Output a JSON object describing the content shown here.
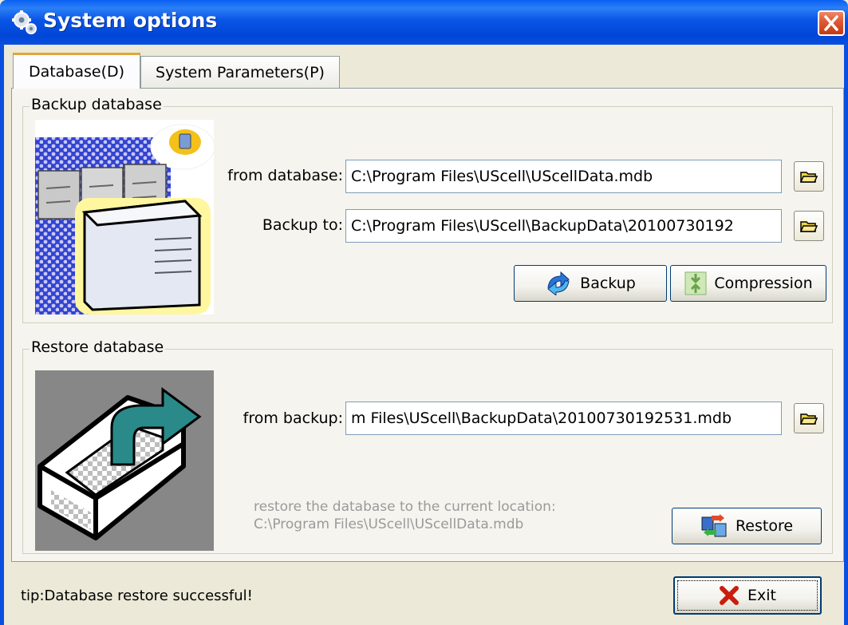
{
  "window": {
    "title": "System options"
  },
  "tabs": [
    {
      "label": "Database(D)",
      "active": true
    },
    {
      "label": "System Parameters(P)",
      "active": false
    }
  ],
  "backup": {
    "group_title": "Backup database",
    "from_label": "from database:",
    "from_value": "C:\\Program Files\\UScell\\UScellData.mdb",
    "to_label": "Backup to:",
    "to_value": "C:\\Program Files\\UScell\\BackupData\\20100730192",
    "backup_button": "Backup",
    "compression_button": "Compression"
  },
  "restore": {
    "group_title": "Restore database",
    "from_label": "from backup:",
    "from_value": "m Files\\UScell\\BackupData\\20100730192531.mdb",
    "note_line1": "restore the database to the current location:",
    "note_line2": "C:\\Program Files\\UScell\\UScellData.mdb",
    "restore_button": "Restore"
  },
  "status": {
    "tip": "tip:Database restore successful!"
  },
  "exit_button": "Exit",
  "colors": {
    "titlebar": "#0a55e6",
    "face": "#ece9d8",
    "field_border": "#7f9db9"
  },
  "icons": [
    "settings-gears-icon",
    "close-icon",
    "folder-open-icon",
    "backup-arrows-icon",
    "compression-icon",
    "restore-icon",
    "exit-x-icon"
  ]
}
